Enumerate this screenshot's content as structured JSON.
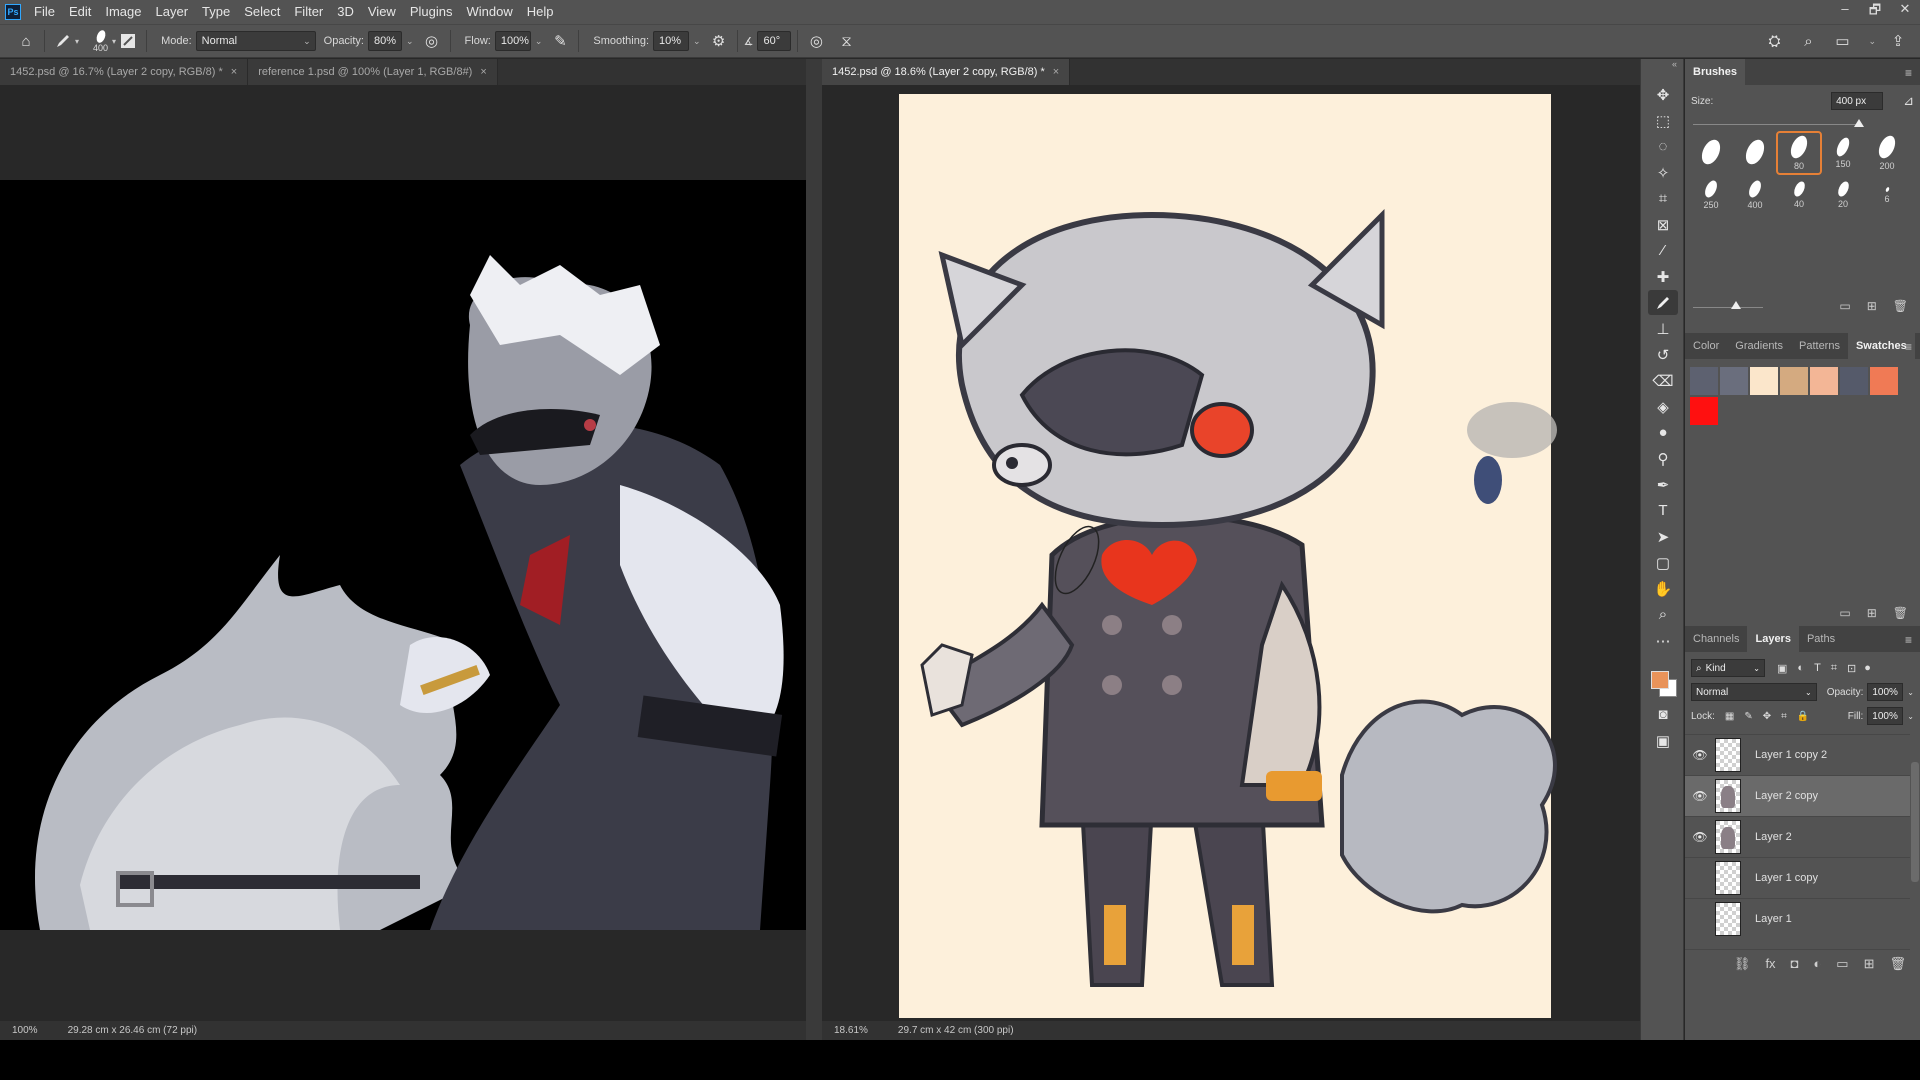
{
  "app": {
    "logo": "Ps"
  },
  "menu": [
    "File",
    "Edit",
    "Image",
    "Layer",
    "Type",
    "Select",
    "Filter",
    "3D",
    "View",
    "Plugins",
    "Window",
    "Help"
  ],
  "window_controls": [
    "–",
    "🗗",
    "✕"
  ],
  "options": {
    "brush_size": "400",
    "mode_label": "Mode:",
    "mode_value": "Normal",
    "opacity_label": "Opacity:",
    "opacity_value": "80%",
    "flow_label": "Flow:",
    "flow_value": "100%",
    "smoothing_label": "Smoothing:",
    "smoothing_value": "10%",
    "angle_value": "60°"
  },
  "left_doc": {
    "tabs": [
      {
        "label": "1452.psd @ 16.7% (Layer 2 copy, RGB/8) *",
        "active": false
      },
      {
        "label": "reference 1.psd @ 100% (Layer 1, RGB/8#)",
        "active": false
      }
    ],
    "zoom": "100%",
    "doc_info": "29.28 cm x 26.46 cm (72 ppi)"
  },
  "right_doc": {
    "tabs": [
      {
        "label": "1452.psd @ 18.6% (Layer 2 copy, RGB/8) *",
        "active": true
      }
    ],
    "zoom": "18.61%",
    "doc_info": "29.7 cm x 42 cm (300 ppi)"
  },
  "tools": [
    "move-icon",
    "marquee-icon",
    "lasso-icon",
    "magic-wand-icon",
    "crop-icon",
    "frame-icon",
    "eyedropper-icon",
    "healing-icon",
    "brush-icon",
    "stamp-icon",
    "history-brush-icon",
    "eraser-icon",
    "bucket-icon",
    "blur-icon",
    "dodge-icon",
    "pen-icon",
    "type-icon",
    "path-select-icon",
    "shape-icon",
    "hand-icon",
    "zoom-icon",
    "more-icon"
  ],
  "brushes": {
    "tabs": [
      "Brushes"
    ],
    "size_label": "Size:",
    "size_value": "400 px",
    "presets": [
      {
        "n": "",
        "w": 16,
        "h": 26
      },
      {
        "n": "",
        "w": 16,
        "h": 26
      },
      {
        "n": "80",
        "w": 14,
        "h": 24,
        "sel": true
      },
      {
        "n": "150",
        "w": 10,
        "h": 20
      },
      {
        "n": "200",
        "w": 14,
        "h": 24
      },
      {
        "n": "250",
        "w": 10,
        "h": 18
      },
      {
        "n": "400",
        "w": 10,
        "h": 18
      },
      {
        "n": "40",
        "w": 9,
        "h": 16
      },
      {
        "n": "20",
        "w": 9,
        "h": 16
      },
      {
        "n": "6",
        "w": 3,
        "h": 5
      }
    ]
  },
  "swatches": {
    "tabs": [
      {
        "label": "Color",
        "active": false
      },
      {
        "label": "Gradients",
        "active": false
      },
      {
        "label": "Patterns",
        "active": false
      },
      {
        "label": "Swatches",
        "active": true
      }
    ],
    "colors": [
      "#5d6170",
      "#6a6e7d",
      "#fbe6cb",
      "#d4aa80",
      "#f3b696",
      "#555a6a",
      "#f07a55",
      "#ff1010"
    ]
  },
  "layers": {
    "tabs": [
      {
        "label": "Channels",
        "active": false
      },
      {
        "label": "Layers",
        "active": true
      },
      {
        "label": "Paths",
        "active": false
      }
    ],
    "filter_label": "Kind",
    "blend_mode": "Normal",
    "opacity_label": "Opacity:",
    "opacity_value": "100%",
    "lock_label": "Lock:",
    "fill_label": "Fill:",
    "fill_value": "100%",
    "items": [
      {
        "name": "Layer 1 copy 2",
        "visible": true,
        "selected": false,
        "art": false
      },
      {
        "name": "Layer 2 copy",
        "visible": true,
        "selected": true,
        "art": true
      },
      {
        "name": "Layer 2",
        "visible": true,
        "selected": false,
        "art": true
      },
      {
        "name": "Layer 1 copy",
        "visible": false,
        "selected": false,
        "art": false
      },
      {
        "name": "Layer 1",
        "visible": false,
        "selected": false,
        "art": false
      }
    ],
    "footer_icons": [
      "link-icon",
      "fx-icon",
      "mask-icon",
      "adjustment-icon",
      "group-icon",
      "new-layer-icon",
      "trash-icon"
    ]
  },
  "colors": {
    "accent": "#e68036",
    "foreground": "#e8935a",
    "background": "#ffffff",
    "canvas_bg": "#fdf0db"
  }
}
